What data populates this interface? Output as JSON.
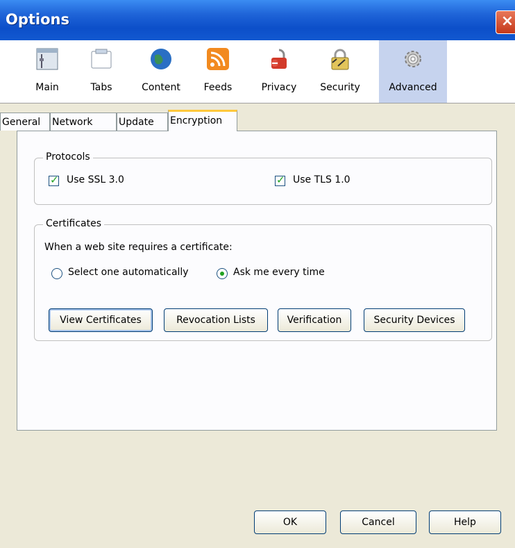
{
  "window": {
    "title": "Options",
    "close_glyph": "×"
  },
  "panes": [
    {
      "label": "Main",
      "icon": "main-icon"
    },
    {
      "label": "Tabs",
      "icon": "tabs-icon"
    },
    {
      "label": "Content",
      "icon": "globe-icon"
    },
    {
      "label": "Feeds",
      "icon": "rss-icon"
    },
    {
      "label": "Privacy",
      "icon": "privacy-icon"
    },
    {
      "label": "Security",
      "icon": "lock-icon"
    },
    {
      "label": "Advanced",
      "icon": "gear-icon",
      "selected": true
    }
  ],
  "tabs": [
    "General",
    "Network",
    "Update",
    "Encryption"
  ],
  "active_tab": "Encryption",
  "protocols": {
    "legend": "Protocols",
    "ssl": {
      "label": "Use SSL 3.0",
      "checked": true
    },
    "tls": {
      "label": "Use TLS 1.0",
      "checked": true
    }
  },
  "certificates": {
    "legend": "Certificates",
    "prompt": "When a web site requires a certificate:",
    "option_auto": "Select one automatically",
    "option_ask": "Ask me every time",
    "selected": "Ask me every time",
    "buttons": {
      "view": "View Certificates",
      "revocation": "Revocation Lists",
      "verification": "Verification",
      "devices": "Security Devices"
    }
  },
  "dialog_buttons": {
    "ok": "OK",
    "cancel": "Cancel",
    "help": "Help"
  },
  "colors": {
    "titlebar": "#0c4fc9",
    "selected_pane": "#c6d3ee",
    "active_tab_accent": "#ffc83c",
    "check": "#21a121"
  }
}
